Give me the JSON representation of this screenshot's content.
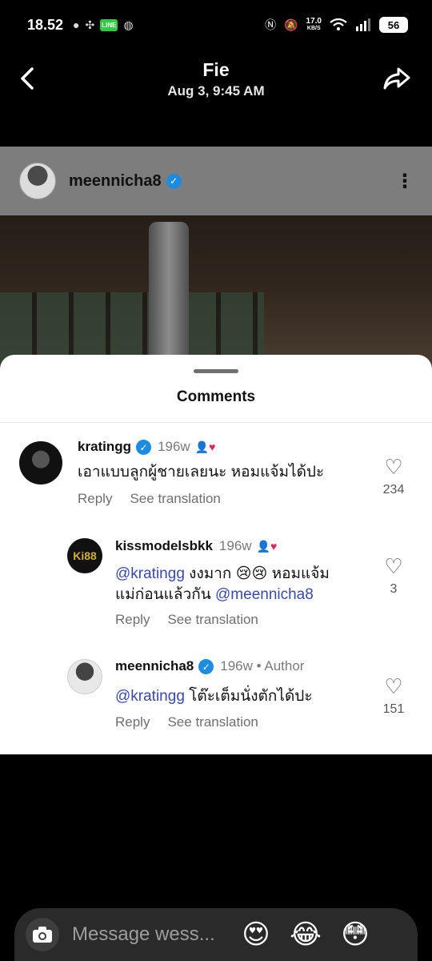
{
  "status_bar": {
    "time": "18.52",
    "net_speed_value": "17.0",
    "net_speed_unit": "KB/S",
    "battery": "56",
    "icons": [
      "chat-bubble-icon",
      "pinwheel-icon",
      "line-app-icon",
      "basketball-icon",
      "nfc-icon",
      "mute-icon",
      "wifi-icon",
      "signal-icon"
    ]
  },
  "header": {
    "title": "Fie",
    "subtitle": "Aug 3, 9:45 AM"
  },
  "post": {
    "username": "meennicha8"
  },
  "comments_sheet": {
    "title": "Comments",
    "comments": [
      {
        "username": "kratingg",
        "time": "196w",
        "text": "เอาแบบลูกผู้ชายเลยนะ หอมแจ้มได้ปะ",
        "reply": "Reply",
        "translate": "See translation",
        "likes": "234"
      },
      {
        "username": "kissmodelsbkk",
        "time": "196w",
        "mention": "@kratingg",
        "text_line1": " งงมาก 😢😢 หอมแจ้ม",
        "text_line2": "แม่ก่อนแล้วกัน ",
        "mention2": "@meennicha8",
        "reply": "Reply",
        "translate": "See translation",
        "likes": "3",
        "avatar_text": "Ki88"
      },
      {
        "username": "meennicha8",
        "time": "196w",
        "author_badge": "Author",
        "mention": "@kratingg",
        "text": " โต๊ะเต็มนั่งตักได้ปะ",
        "reply": "Reply",
        "translate": "See translation",
        "likes": "151"
      }
    ]
  },
  "message_bar": {
    "placeholder": "Message wess...",
    "emojis": [
      "😍",
      "😂",
      "😳"
    ]
  }
}
